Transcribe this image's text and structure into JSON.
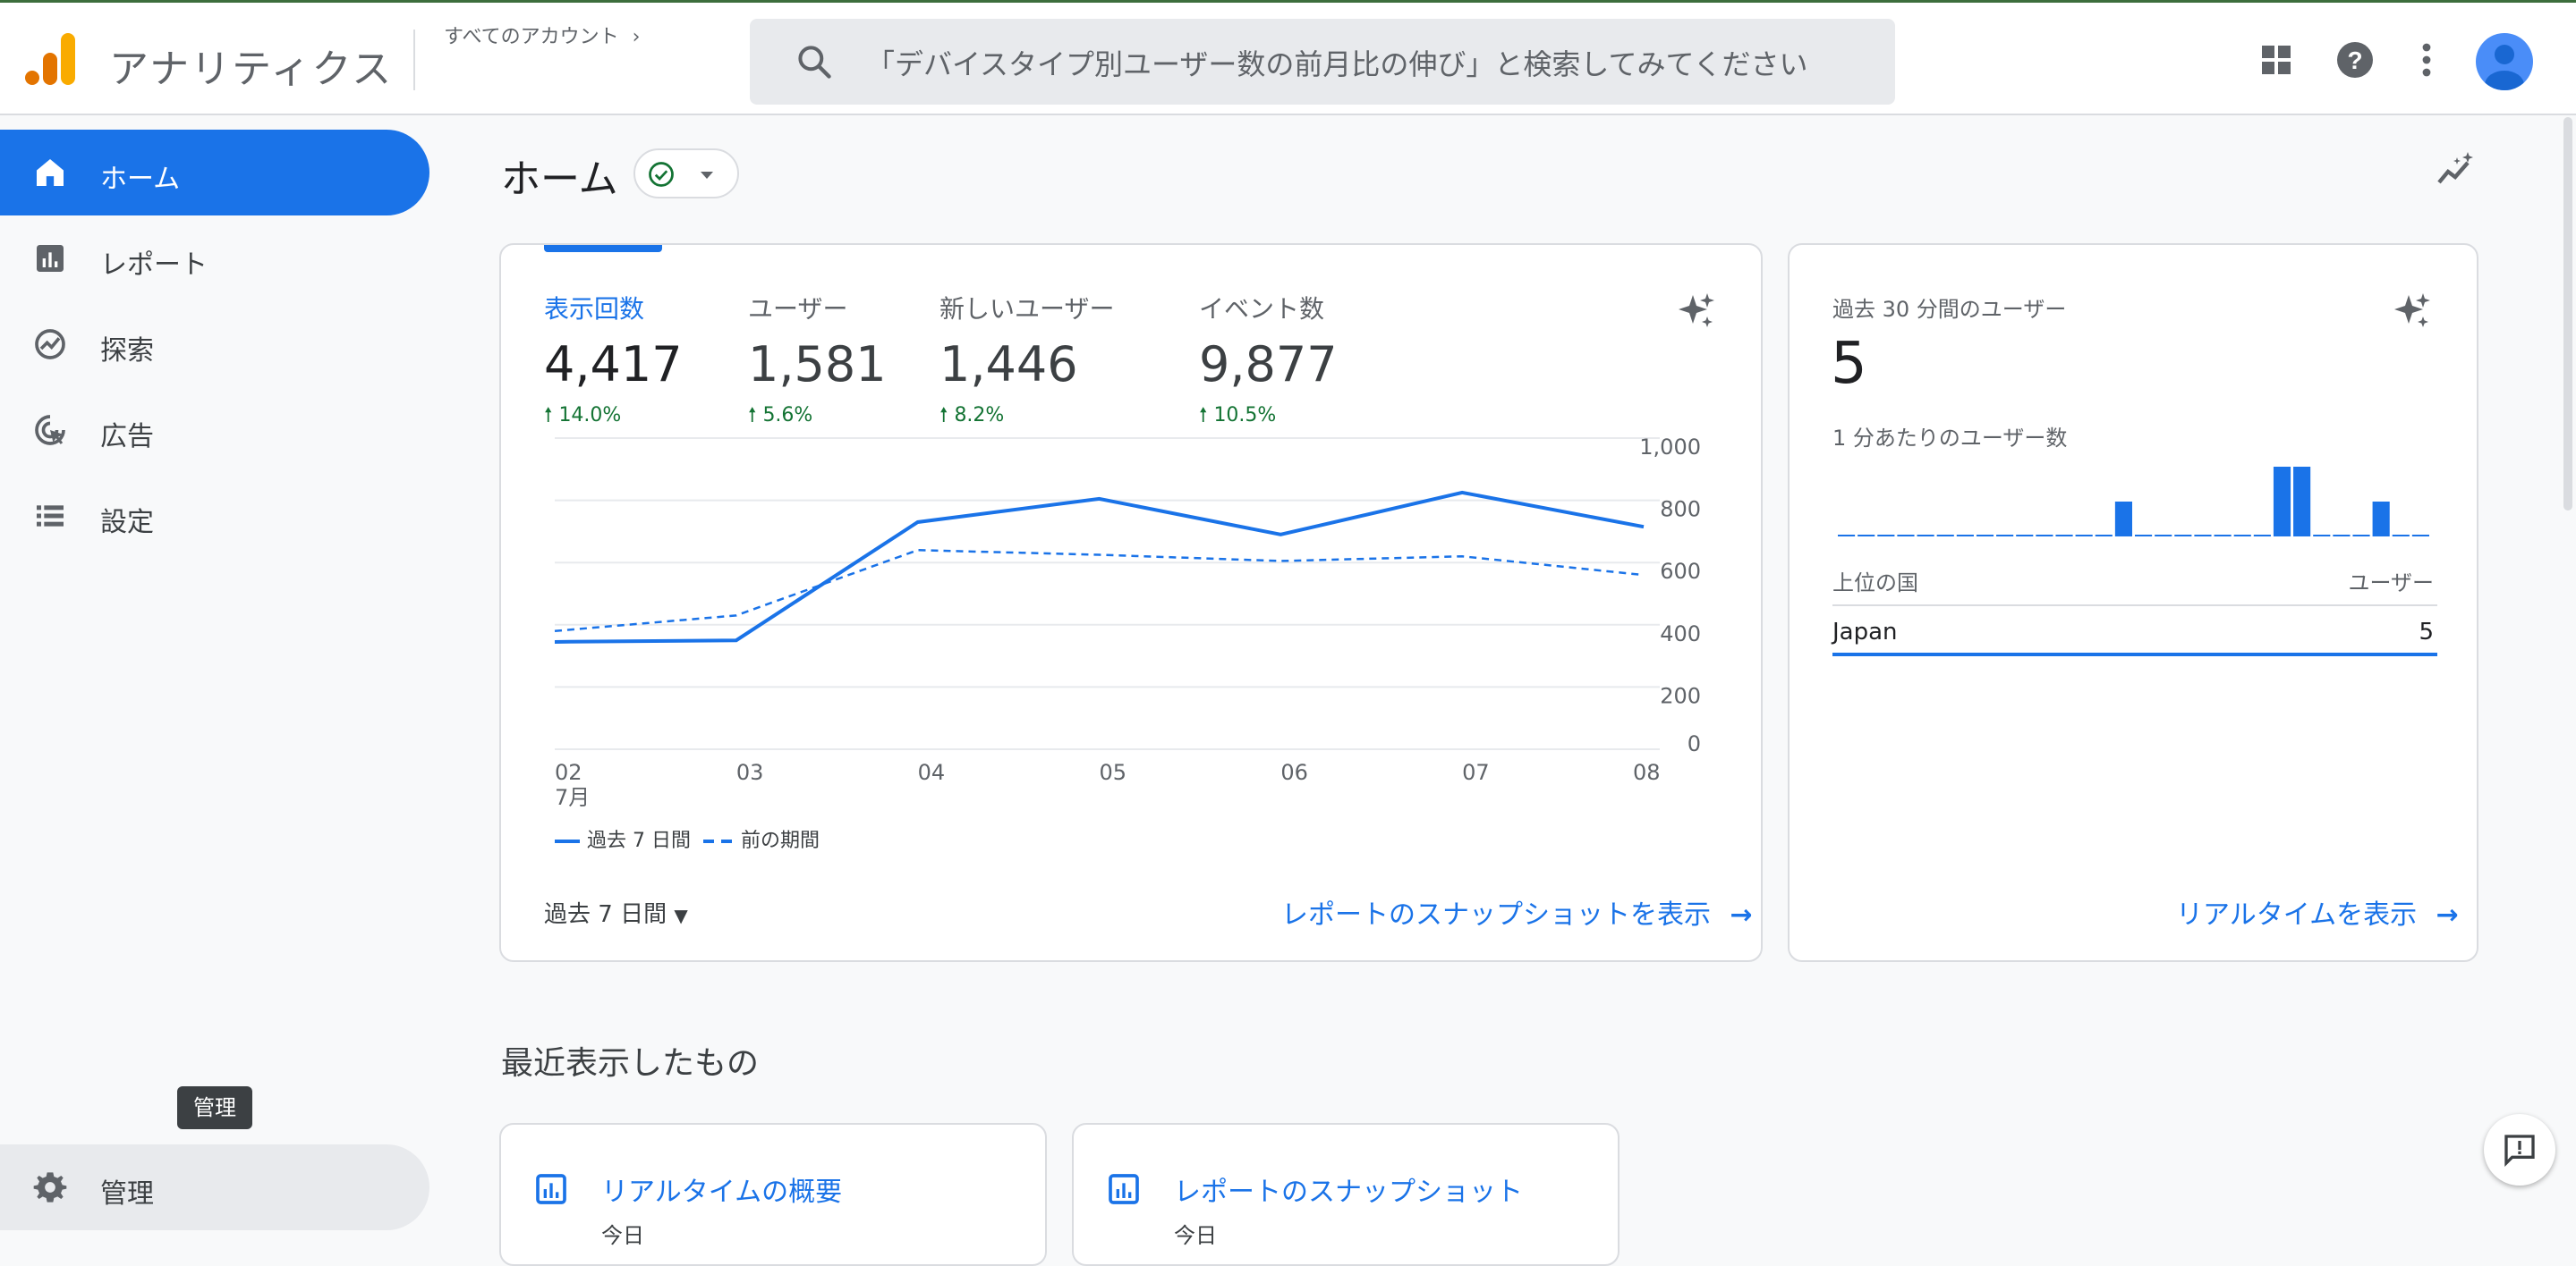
{
  "header": {
    "app_title": "アナリティクス",
    "account_breadcrumb": "すべてのアカウント",
    "search_placeholder": "「デバイスタイプ別ユーザー数の前月比の伸び」と検索してみてください"
  },
  "sidebar": {
    "items": [
      {
        "label": "ホーム",
        "icon": "home-icon",
        "active": true
      },
      {
        "label": "レポート",
        "icon": "reports-icon"
      },
      {
        "label": "探索",
        "icon": "explore-icon"
      },
      {
        "label": "広告",
        "icon": "advertising-icon"
      },
      {
        "label": "設定",
        "icon": "configure-icon"
      }
    ],
    "admin_label": "管理",
    "admin_tooltip": "管理"
  },
  "main": {
    "page_title": "ホーム",
    "overview": {
      "metrics": [
        {
          "label": "表示回数",
          "value": "4,417",
          "change": "14.0%",
          "active": true
        },
        {
          "label": "ユーザー",
          "value": "1,581",
          "change": "5.6%"
        },
        {
          "label": "新しいユーザー",
          "value": "1,446",
          "change": "8.2%"
        },
        {
          "label": "イベント数",
          "value": "9,877",
          "change": "10.5%"
        }
      ],
      "period_selector": "過去 7 日間",
      "snapshot_link": "レポートのスナップショットを表示"
    },
    "realtime": {
      "title": "過去 30 分間のユーザー",
      "value": "5",
      "per_minute_label": "1 分あたりのユーザー数",
      "per_minute_values": [
        0,
        0,
        0,
        0,
        0,
        0,
        0,
        0,
        0,
        0,
        0,
        0,
        0,
        0,
        1,
        0,
        0,
        0,
        0,
        0,
        0,
        0,
        2,
        2,
        0,
        0,
        0,
        1,
        0,
        0
      ],
      "country_header": "上位の国",
      "users_header": "ユーザー",
      "countries": [
        {
          "name": "Japan",
          "users": "5"
        }
      ],
      "link": "リアルタイムを表示"
    },
    "recent_title": "最近表示したもの",
    "recent": [
      {
        "title": "リアルタイムの概要",
        "subtitle": "今日"
      },
      {
        "title": "レポートのスナップショット",
        "subtitle": "今日"
      }
    ]
  },
  "chart_data": {
    "type": "line",
    "x": [
      "02",
      "03",
      "04",
      "05",
      "06",
      "07",
      "08"
    ],
    "x_sublabel": "7月",
    "series": [
      {
        "name": "過去 7 日間",
        "values": [
          345,
          350,
          730,
          805,
          690,
          825,
          715
        ]
      },
      {
        "name": "前の期間",
        "values": [
          380,
          430,
          640,
          625,
          605,
          620,
          560
        ]
      }
    ],
    "ylim": [
      0,
      1000
    ],
    "y_ticks": [
      "0",
      "200",
      "400",
      "600",
      "800",
      "1,000"
    ],
    "legend_placement": "bottom-left",
    "grid": true
  }
}
